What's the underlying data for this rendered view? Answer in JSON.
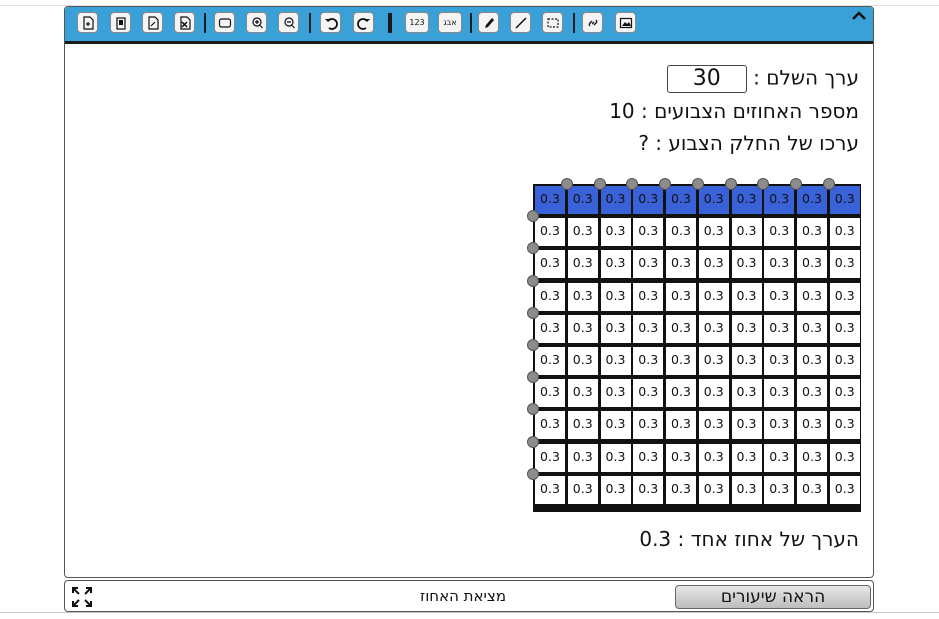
{
  "toolbar": {
    "buttons": [
      {
        "name": "new-page-icon",
        "label": ""
      },
      {
        "name": "paste-icon",
        "label": ""
      },
      {
        "name": "file-icon",
        "label": ""
      },
      {
        "name": "delete-page-icon",
        "label": ""
      },
      {
        "name": "rectangle-icon",
        "label": ""
      },
      {
        "name": "zoom-in-icon",
        "label": ""
      },
      {
        "name": "zoom-out-icon",
        "label": ""
      },
      {
        "name": "undo-icon",
        "label": ""
      },
      {
        "name": "redo-icon",
        "label": ""
      },
      {
        "name": "numbers-icon",
        "label": "123"
      },
      {
        "name": "letters-icon",
        "label": "אבג"
      },
      {
        "name": "pen-icon",
        "label": ""
      },
      {
        "name": "line-icon",
        "label": ""
      },
      {
        "name": "select-icon",
        "label": ""
      },
      {
        "name": "link-icon",
        "label": ""
      },
      {
        "name": "image-icon",
        "label": ""
      }
    ]
  },
  "content": {
    "whole_label": "ערך השלם :",
    "whole_value": "30",
    "colored_label": "מספר האחוזים הצבועים :",
    "colored_value": "10",
    "colored_part_label": "ערכו של החלק הצבוע :",
    "colored_part_value": "?",
    "one_percent_label": "הערך של אחוז אחד :",
    "one_percent_value": "0.3"
  },
  "grid": {
    "rows": 10,
    "cols": 10,
    "cell_value": "0.3",
    "colored_rows": 1,
    "fill_color": "#3a62d8",
    "empty_color": "#ffffff"
  },
  "bottom": {
    "title": "מציאת האחוז",
    "lessons_button": "הראה שיעורים"
  },
  "colors": {
    "toolbar": "#3aa0d8",
    "grid_border": "#111111",
    "handle": "#8c8c8c"
  }
}
